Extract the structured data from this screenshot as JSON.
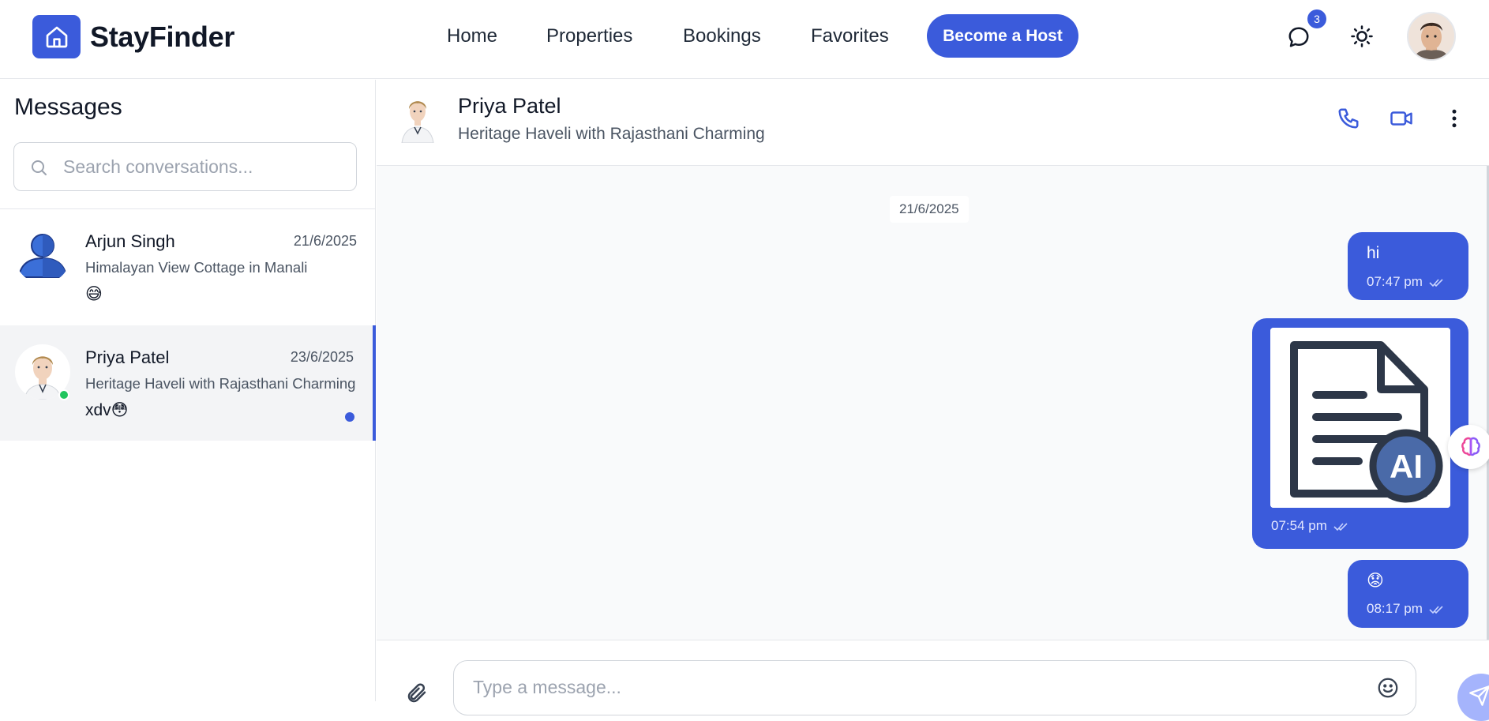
{
  "app": {
    "brand": "StayFinder",
    "accent_color": "#3b5bdb",
    "logo_icon": "home-icon"
  },
  "nav": {
    "links": [
      "Home",
      "Properties",
      "Bookings",
      "Favorites"
    ],
    "cta_label": "Become a Host",
    "messages_badge": "3",
    "icons": [
      "chat-bubble-icon",
      "sun-icon"
    ]
  },
  "sidebar": {
    "title": "Messages",
    "search_placeholder": "Search conversations...",
    "conversations": [
      {
        "name": "Arjun Singh",
        "date": "21/6/2025",
        "property": "Himalayan View Cottage in Manali",
        "last_message": "😅",
        "online": false,
        "unread": false,
        "active": false
      },
      {
        "name": "Priya Patel",
        "date": "23/6/2025",
        "property": "Heritage Haveli with Rajasthani Charming",
        "last_message": "xdv😳",
        "online": true,
        "unread": true,
        "active": true
      }
    ]
  },
  "chat": {
    "contact_name": "Priya Patel",
    "property": "Heritage Haveli with Rajasthani Charming",
    "header_icons": [
      "phone-icon",
      "video-icon",
      "more-vertical-icon"
    ],
    "date_separator": "21/6/2025",
    "messages": [
      {
        "type": "text",
        "text": "hi",
        "time": "07:47 pm",
        "status": "read"
      },
      {
        "type": "image",
        "image_desc": "document-ai-icon",
        "time": "07:54 pm",
        "status": "read"
      },
      {
        "type": "text",
        "text": "😟",
        "time": "08:17 pm",
        "status": "read"
      }
    ],
    "composer_placeholder": "Type a message..."
  }
}
